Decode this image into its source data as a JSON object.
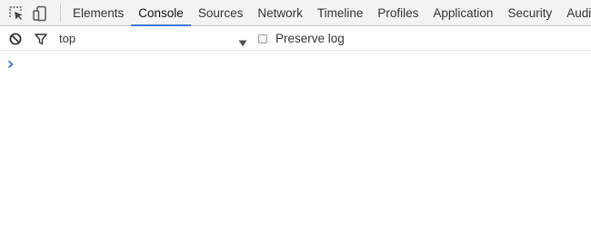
{
  "toolbar": {
    "inspect_icon": "inspect-element-icon",
    "device_icon": "device-mode-icon"
  },
  "tabs": [
    {
      "label": "Elements"
    },
    {
      "label": "Console",
      "active": true
    },
    {
      "label": "Sources"
    },
    {
      "label": "Network"
    },
    {
      "label": "Timeline"
    },
    {
      "label": "Profiles"
    },
    {
      "label": "Application"
    },
    {
      "label": "Security"
    },
    {
      "label": "Audits"
    }
  ],
  "console_toolbar": {
    "clear_icon": "clear-console-icon",
    "filter_icon": "filter-icon",
    "context": "top",
    "preserve_log_label": "Preserve log",
    "preserve_log_checked": false
  },
  "console": {
    "prompt_icon": "chevron-right-icon",
    "input_value": ""
  },
  "colors": {
    "accent": "#3879d9",
    "tabbar_bg": "#f3f3f3"
  }
}
